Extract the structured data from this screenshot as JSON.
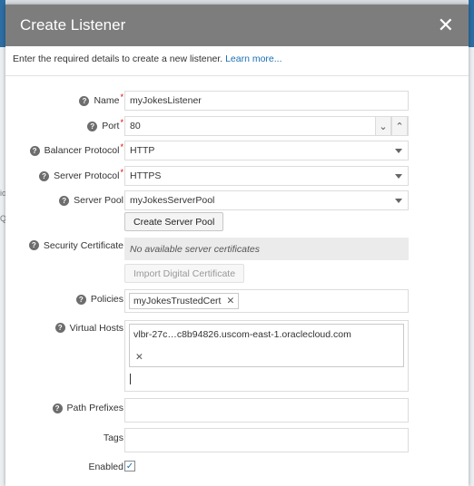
{
  "dialog": {
    "title": "Create Listener",
    "intro": "Enter the required details to create a new listener.",
    "intro_link": "Learn more..."
  },
  "background": {
    "glyph_a": "io",
    "glyph_b": "Q"
  },
  "form": {
    "name": {
      "label": "Name",
      "required": true,
      "value": "myJokesListener"
    },
    "port": {
      "label": "Port",
      "required": true,
      "value": "80"
    },
    "balancer_protocol": {
      "label": "Balancer Protocol",
      "required": true,
      "value": "HTTP"
    },
    "server_protocol": {
      "label": "Server Protocol",
      "required": true,
      "value": "HTTPS"
    },
    "server_pool": {
      "label": "Server Pool",
      "value": "myJokesServerPool",
      "create_button": "Create Server Pool"
    },
    "security_certificate": {
      "label": "Security Certificate",
      "placeholder": "No available server certificates",
      "import_button": "Import Digital Certificate"
    },
    "policies": {
      "label": "Policies",
      "chips": [
        "myJokesTrustedCert"
      ]
    },
    "virtual_hosts": {
      "label": "Virtual Hosts",
      "chips": [
        "vlbr-27c…c8b94826.uscom-east-1.oraclecloud.com"
      ]
    },
    "path_prefixes": {
      "label": "Path Prefixes",
      "value": ""
    },
    "tags": {
      "label": "Tags",
      "value": ""
    },
    "enabled": {
      "label": "Enabled",
      "checked": true
    }
  },
  "icons": {
    "help": "question-circle-icon",
    "close": "close-icon",
    "dropdown": "caret-down-icon",
    "stepper_down": "chevron-down-icon",
    "stepper_up": "chevron-up-icon",
    "remove": "remove-x-icon",
    "check": "checkmark-icon"
  },
  "colors": {
    "header": "#7d7d7d",
    "link": "#1a6fb5",
    "required": "#d00000"
  }
}
